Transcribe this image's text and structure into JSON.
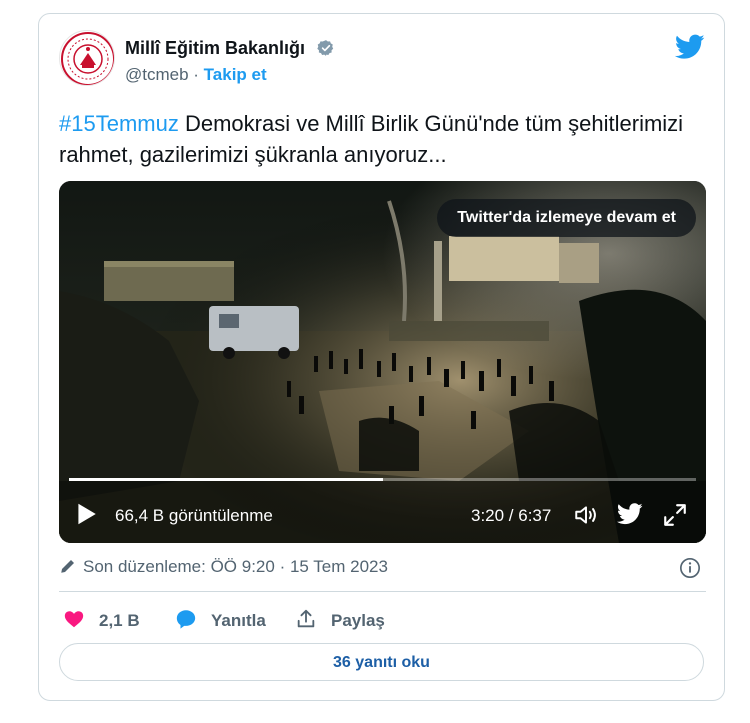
{
  "account": {
    "name": "Millî Eğitim Bakanlığı",
    "handle": "@tcmeb",
    "separator": " · ",
    "follow_label": "Takip et",
    "verified": true
  },
  "tweet": {
    "hashtag": "#15Temmuz",
    "text": " Demokrasi ve Millî Birlik Günü'nde tüm şehitlerimizi rahmet, gazilerimizi şükranla anıyoruz..."
  },
  "video": {
    "continue_label": "Twitter'da izlemeye devam et",
    "views": "66,4 B görüntülenme",
    "time": "3:20 / 6:37",
    "progress": 0.5
  },
  "meta": {
    "edited_label": "Son düzenleme: ÖÖ 9:20 · 15 Tem 2023"
  },
  "actions": {
    "likes": "2,1 B",
    "reply_label": "Yanıtla",
    "share_label": "Paylaş",
    "read_replies_label": "36 yanıtı oku"
  },
  "colors": {
    "accent": "#1d9bf0",
    "like": "#f91880",
    "text": "#0f1419",
    "muted": "#536471",
    "border": "#cfd9de",
    "emblem": "#c8102e"
  }
}
